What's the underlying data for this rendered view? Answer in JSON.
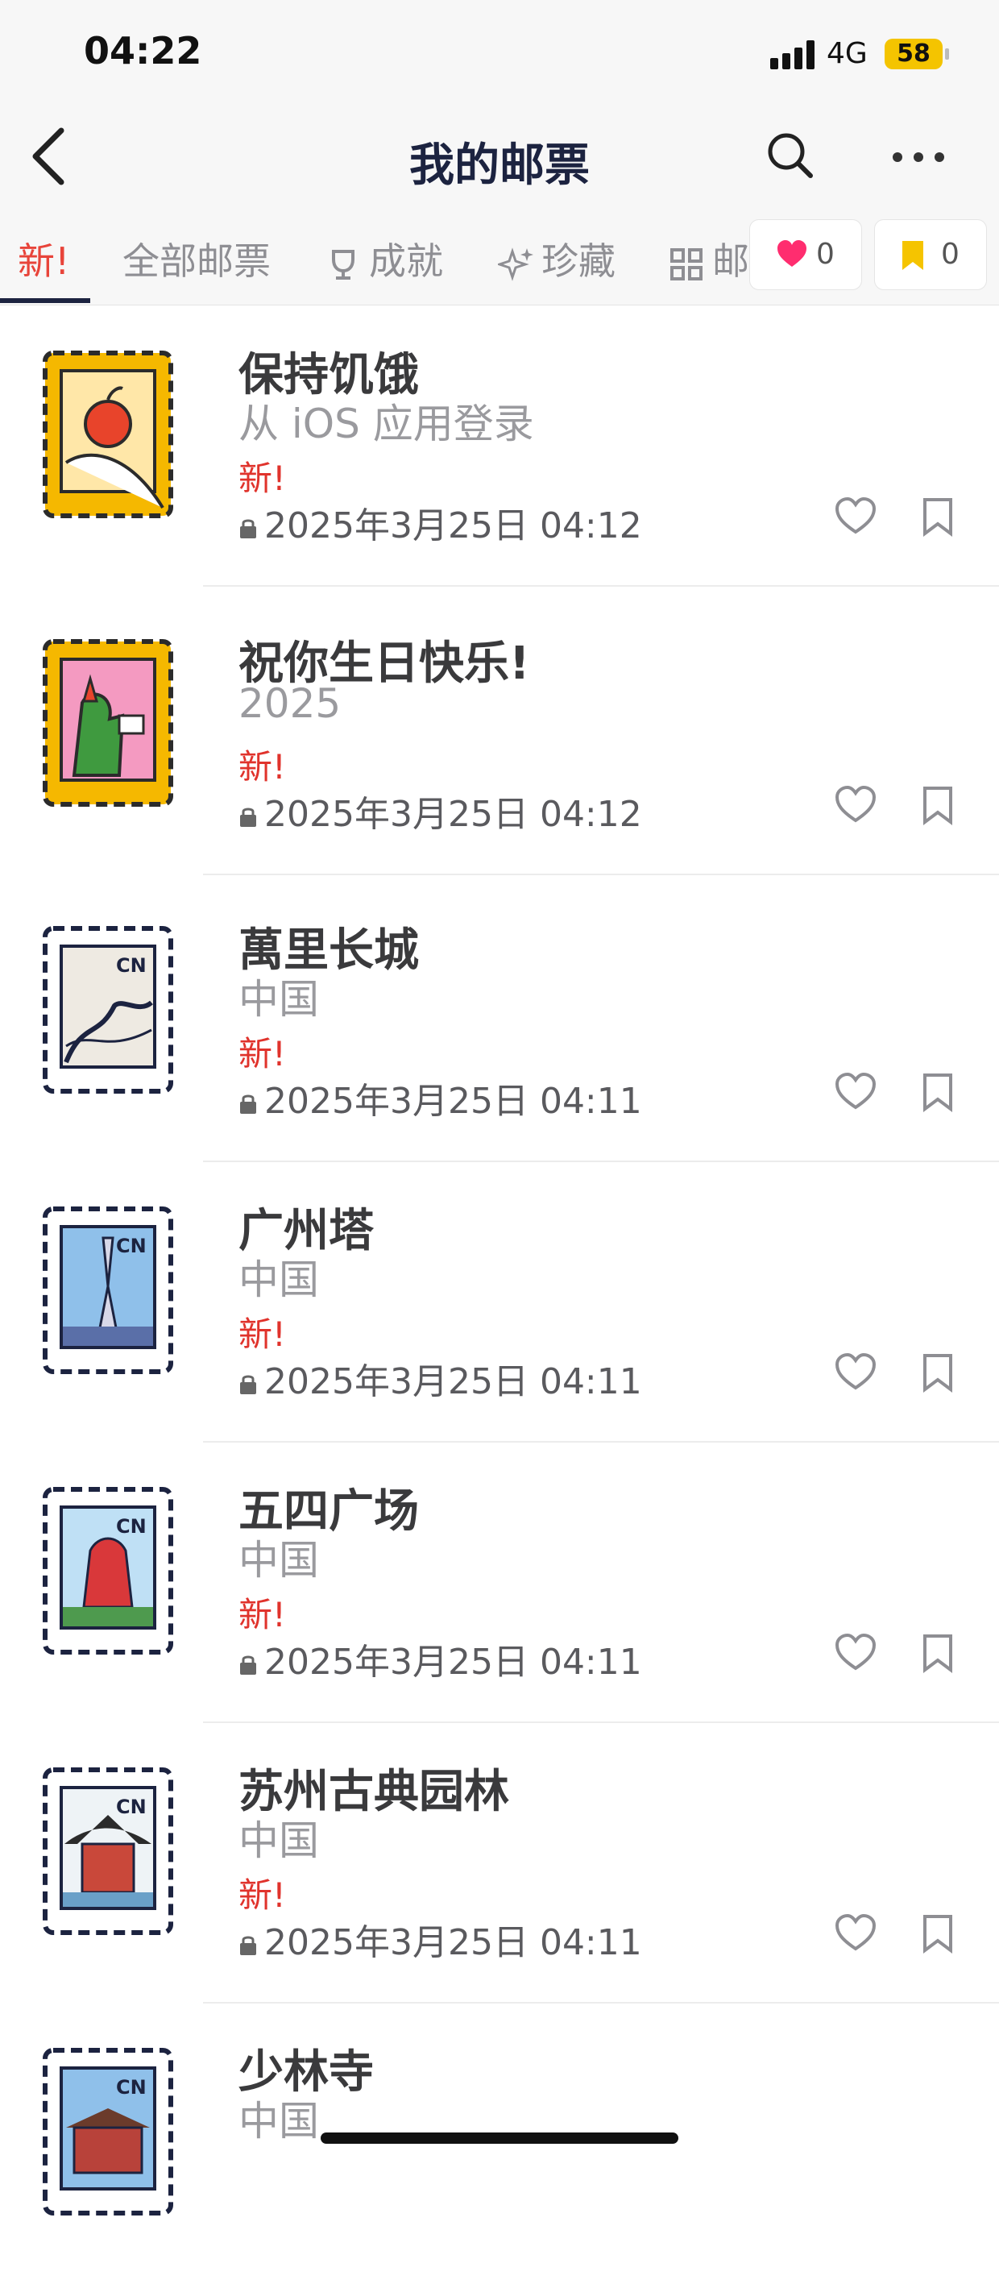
{
  "status_bar": {
    "time": "04:22",
    "network": "4G",
    "battery": "58"
  },
  "nav": {
    "title": "我的邮票"
  },
  "tabs": [
    {
      "label": "新!",
      "icon": "",
      "active": true
    },
    {
      "label": "全部邮票",
      "icon": ""
    },
    {
      "label": "成就",
      "icon": "trophy-icon"
    },
    {
      "label": "珍藏",
      "icon": "sparkle-icon"
    },
    {
      "label": "邮",
      "icon": "grid-icon"
    }
  ],
  "counters": {
    "likes": "0",
    "bookmarks": "0",
    "like_color": "#ff2d6f",
    "bookmark_color": "#f5c400"
  },
  "accent": {
    "new_badge": "#e0332c",
    "title": "#1c2340"
  },
  "stamps": [
    {
      "name": "保持饥饿",
      "subtitle": "从 iOS 应用登录",
      "badge": "新!",
      "date": "2025年3月25日 04:12",
      "icon": "apple-hand-stamp"
    },
    {
      "name": "祝你生日快乐!",
      "subtitle": "2025",
      "badge": "新!",
      "date": "2025年3月25日 04:12",
      "icon": "birthday-crocodile-stamp"
    },
    {
      "name": "萬里长城",
      "subtitle": "中国",
      "badge": "新!",
      "date": "2025年3月25日 04:11",
      "icon": "great-wall-stamp"
    },
    {
      "name": "广州塔",
      "subtitle": "中国",
      "badge": "新!",
      "date": "2025年3月25日 04:11",
      "icon": "canton-tower-stamp"
    },
    {
      "name": "五四广场",
      "subtitle": "中国",
      "badge": "新!",
      "date": "2025年3月25日 04:11",
      "icon": "may-fourth-square-stamp"
    },
    {
      "name": "苏州古典园林",
      "subtitle": "中国",
      "badge": "新!",
      "date": "2025年3月25日 04:11",
      "icon": "suzhou-garden-stamp"
    },
    {
      "name": "少林寺",
      "subtitle": "中国",
      "badge": "",
      "date": "",
      "icon": "shaolin-temple-stamp"
    }
  ]
}
